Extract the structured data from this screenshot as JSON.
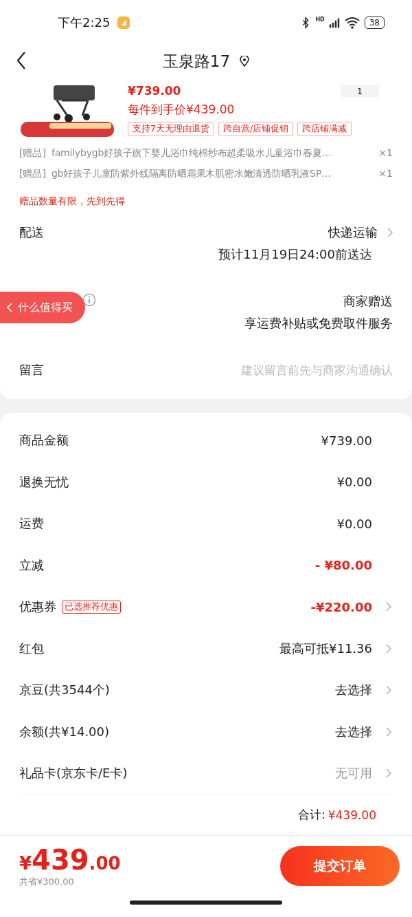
{
  "status_bar": {
    "time": "下午2:25",
    "network": "HD",
    "battery": "38"
  },
  "header": {
    "title": "玉泉路17"
  },
  "product": {
    "price": "¥739.00",
    "final_price": "每件到手价¥439.00",
    "quantity": "1",
    "tags": [
      "支持7天无理由退货",
      "跨自营/店铺促销",
      "跨店铺满减"
    ]
  },
  "gifts": [
    {
      "label": "[赠品]",
      "name": "familybygb好孩子旗下婴儿浴巾纯棉纱布超柔吸水儿童浴巾春夏…",
      "qty": "×1"
    },
    {
      "label": "[赠品]",
      "name": "gb好孩子儿童防紫外线隔离防晒霜果木肌密水嫩清透防晒乳液SP…",
      "qty": "×1"
    }
  ],
  "gift_notice": "赠品数量有限，先到先得",
  "delivery": {
    "label": "配送",
    "method": "快递运输",
    "eta": "预计11月19日24:00前送达"
  },
  "returns": {
    "value": "商家赠送",
    "detail": "享运费补贴或免费取件服务"
  },
  "floating_button": "什么值得买",
  "message": {
    "label": "留言",
    "placeholder": "建议留言前先与商家沟通确认"
  },
  "summary": [
    {
      "label": "商品金额",
      "value": "¥739.00",
      "kind": "amount",
      "chevron": false
    },
    {
      "label": "退换无忧",
      "value": "¥0.00",
      "kind": "amount",
      "chevron": false
    },
    {
      "label": "运费",
      "value": "¥0.00",
      "kind": "amount",
      "chevron": false
    },
    {
      "label": "立减",
      "value": "- ¥80.00",
      "kind": "discount",
      "chevron": false
    },
    {
      "label": "优惠券",
      "badge": "已选推荐优惠",
      "value": "-¥220.00",
      "kind": "discount",
      "chevron": true
    },
    {
      "label": "红包",
      "value": "最高可抵¥11.36",
      "kind": "amount",
      "chevron": true
    },
    {
      "label": "京豆(共3544个)",
      "value": "去选择",
      "kind": "amount",
      "chevron": true
    },
    {
      "label": "余额(共¥14.00)",
      "value": "去选择",
      "kind": "amount",
      "chevron": true
    },
    {
      "label": "礼品卡(京东卡/E卡)",
      "value": "无可用",
      "kind": "unavailable",
      "chevron": true
    }
  ],
  "total": {
    "label": "合计:",
    "value": "¥439.00"
  },
  "footer": {
    "currency": "¥",
    "amount": "439",
    "cents": ".00",
    "saved": "共省¥300.00",
    "submit": "提交订单"
  }
}
